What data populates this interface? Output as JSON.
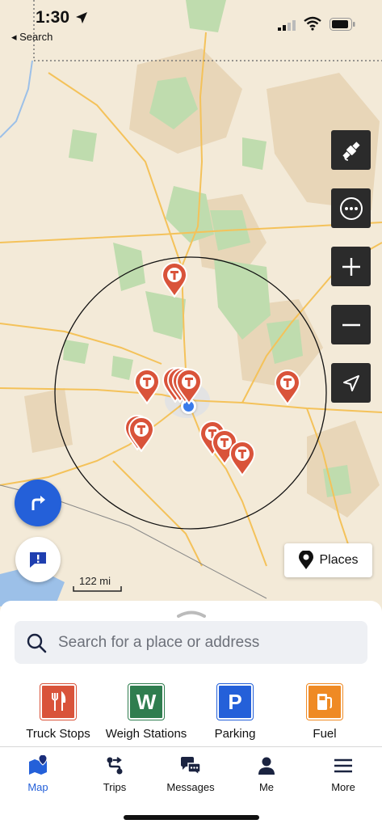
{
  "status_bar": {
    "time": "1:30",
    "back_label": "◂ Search"
  },
  "map": {
    "scale_label": "122 mi",
    "places_label": "Places",
    "colors": {
      "land": "#f3ead8",
      "forest": "#bfdcae",
      "road": "#f4c25a",
      "pin": "#d9533a",
      "route_button": "#2460d9"
    }
  },
  "search": {
    "placeholder": "Search for a place or address"
  },
  "categories": [
    {
      "label": "Truck Stops",
      "icon": "fork-knife-icon",
      "color": "#d9533a"
    },
    {
      "label": "Weigh Stations",
      "icon": "W",
      "color": "#2f7d4f"
    },
    {
      "label": "Parking",
      "icon": "P",
      "color": "#2460d9"
    },
    {
      "label": "Fuel",
      "icon": "fuel-pump-icon",
      "color": "#ef8a24"
    }
  ],
  "tabs": [
    {
      "label": "Map",
      "icon": "map-pin-icon",
      "active": true
    },
    {
      "label": "Trips",
      "icon": "route-icon"
    },
    {
      "label": "Messages",
      "icon": "chat-bubbles-icon"
    },
    {
      "label": "Me",
      "icon": "person-icon"
    },
    {
      "label": "More",
      "icon": "hamburger-icon"
    }
  ]
}
